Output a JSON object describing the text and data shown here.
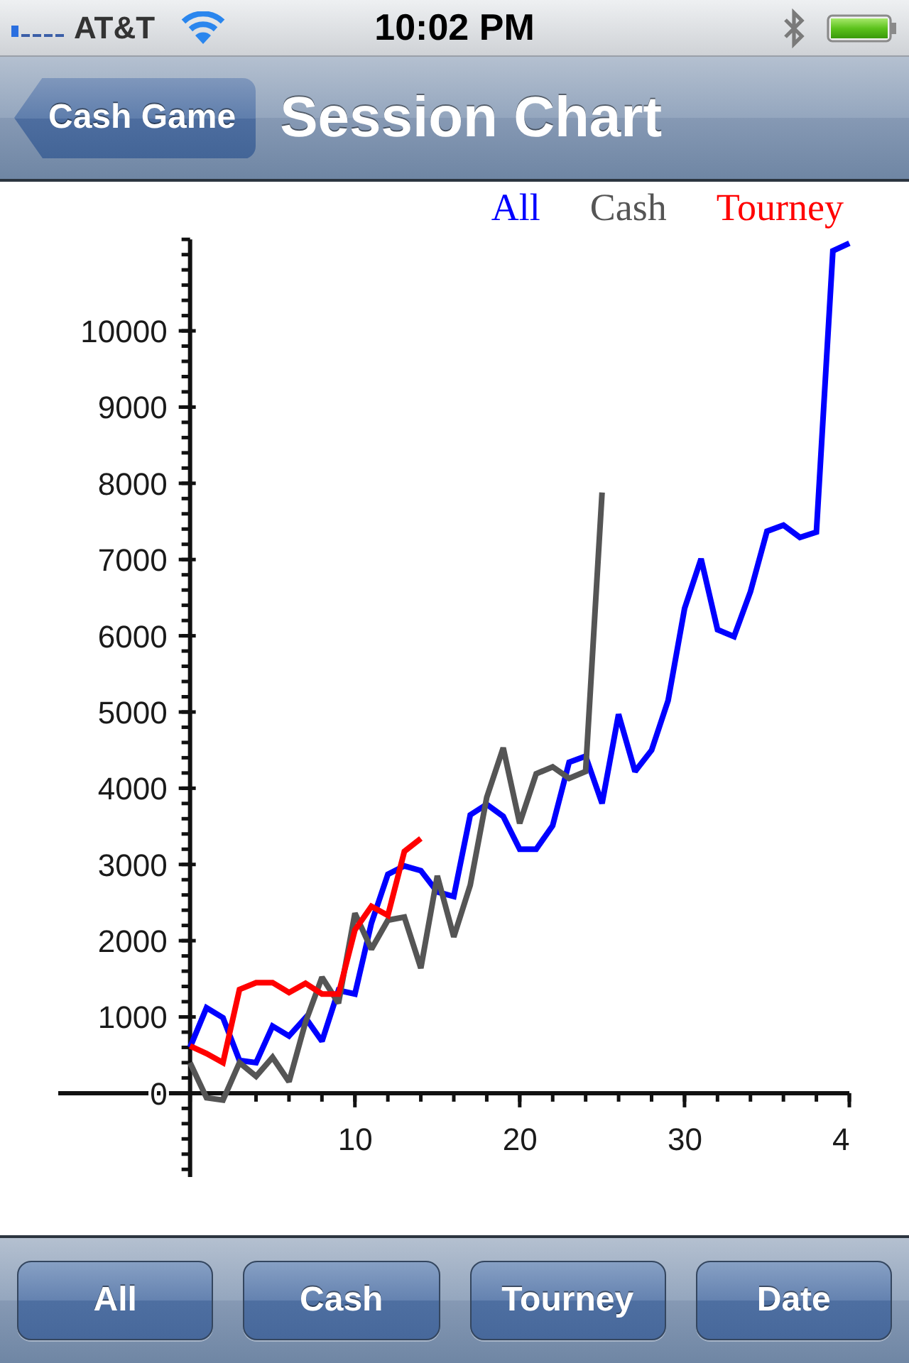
{
  "status_bar": {
    "carrier": "AT&T",
    "time": "10:02 PM"
  },
  "nav_bar": {
    "back_button": "Cash Game",
    "title": "Session Chart"
  },
  "chart": {
    "chart_data": {
      "type": "line",
      "x": [
        0,
        1,
        2,
        3,
        4,
        5,
        6,
        7,
        8,
        9,
        10,
        11,
        12,
        13,
        14,
        15,
        16,
        17,
        18,
        19,
        20,
        21,
        22,
        23,
        24,
        25,
        26,
        27,
        28,
        29,
        30,
        31,
        32,
        33,
        34,
        35,
        36,
        37,
        38,
        39,
        40
      ],
      "series": [
        {
          "name": "All",
          "color": "#0000ff",
          "values": [
            600,
            1120,
            990,
            430,
            400,
            880,
            750,
            990,
            680,
            1350,
            1300,
            2230,
            2870,
            2980,
            2920,
            2640,
            2580,
            3650,
            3790,
            3630,
            3200,
            3200,
            3510,
            4340,
            4420,
            3800,
            4970,
            4220,
            4500,
            5150,
            6360,
            7010,
            6080,
            5990,
            6580,
            7370,
            7450,
            7290,
            7360,
            11050,
            11150
          ]
        },
        {
          "name": "Cash",
          "color": "#555555",
          "values": [
            400,
            -60,
            -90,
            400,
            220,
            470,
            150,
            930,
            1520,
            1180,
            2360,
            1890,
            2270,
            2310,
            1640,
            2850,
            2050,
            2730,
            3880,
            4530,
            3540,
            4190,
            4280,
            4130,
            4220,
            7880,
            null,
            null,
            null,
            null,
            null,
            null,
            null,
            null,
            null,
            null,
            null,
            null,
            null,
            null,
            null
          ]
        },
        {
          "name": "Tourney",
          "color": "#ff0000",
          "values": [
            620,
            520,
            400,
            1360,
            1450,
            1450,
            1320,
            1440,
            1300,
            1300,
            2140,
            2450,
            2330,
            3170,
            3340,
            null,
            null,
            null,
            null,
            null,
            null,
            null,
            null,
            null,
            null,
            null,
            null,
            null,
            null,
            null,
            null,
            null,
            null,
            null,
            null,
            null,
            null,
            null,
            null,
            null,
            null
          ]
        }
      ],
      "xlim": [
        -8,
        40
      ],
      "ylim": [
        -1100,
        11200
      ],
      "xticks": [
        10,
        20,
        30
      ],
      "yticks": [
        0,
        1000,
        2000,
        3000,
        4000,
        5000,
        6000,
        7000,
        8000,
        9000,
        10000
      ]
    },
    "x_axis_end_label": "4"
  },
  "toolbar": {
    "buttons": [
      "All",
      "Cash",
      "Tourney",
      "Date"
    ]
  }
}
